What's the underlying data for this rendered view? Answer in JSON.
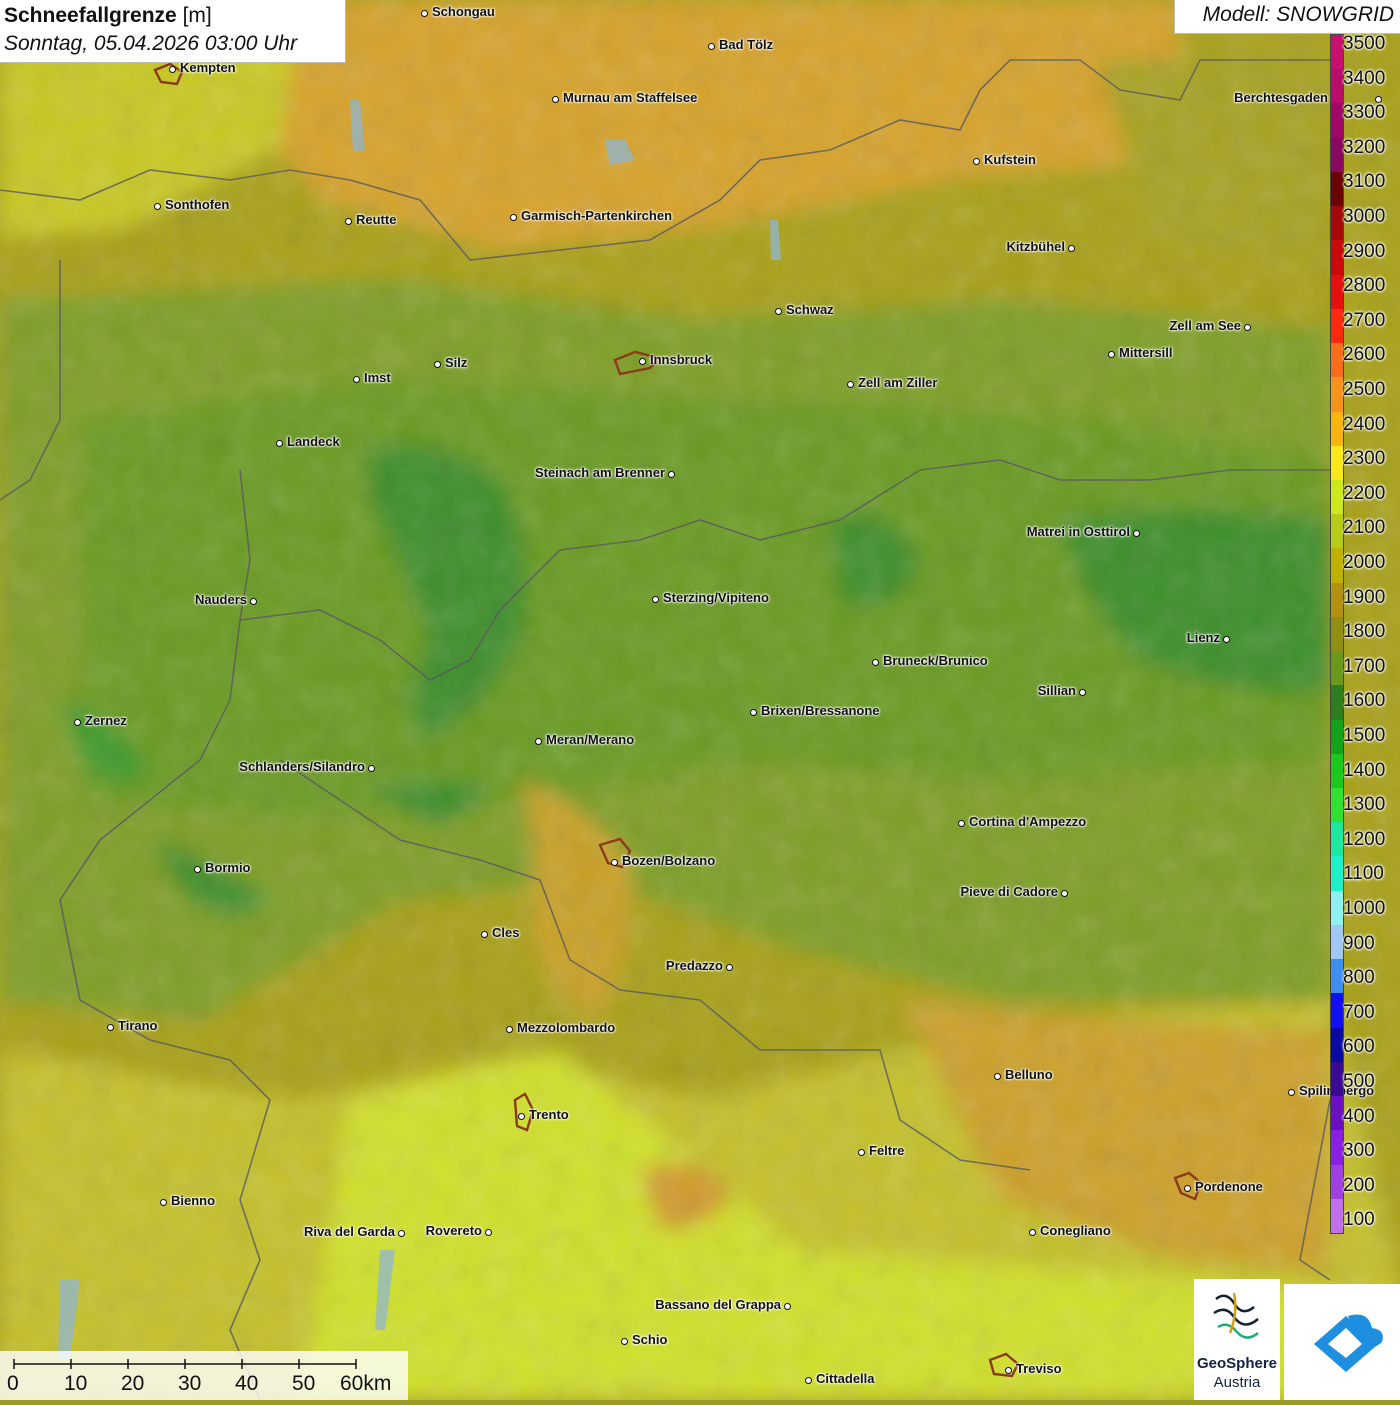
{
  "header": {
    "title_bold": "Schneefallgrenze",
    "title_unit": "[m]",
    "datetime": "Sonntag, 05.04.2026 03:00 Uhr",
    "model": "Modell: SNOWGRID"
  },
  "legend": {
    "labels": [
      "3500",
      "3400",
      "3300",
      "3200",
      "3100",
      "3000",
      "2900",
      "2800",
      "2700",
      "2600",
      "2500",
      "2400",
      "2300",
      "2200",
      "2100",
      "2000",
      "1900",
      "1800",
      "1700",
      "1600",
      "1500",
      "1400",
      "1300",
      "1200",
      "1100",
      "1000",
      "900",
      "800",
      "700",
      "600",
      "500",
      "400",
      "300",
      "200",
      "100"
    ],
    "colors": [
      "#c8106e",
      "#b80d6a",
      "#a00a66",
      "#8a0860",
      "#6a0505",
      "#a40a0a",
      "#c80a0a",
      "#e41010",
      "#fb2a0f",
      "#f76d1a",
      "#f6931a",
      "#f8b410",
      "#fbe81a",
      "#cbe91c",
      "#b6cc18",
      "#c0b000",
      "#b49010",
      "#8f8f12",
      "#6b9a1a",
      "#2e7d1e",
      "#15a11a",
      "#1cc81c",
      "#32e032",
      "#1ee8a0",
      "#20f0c8",
      "#90f0f0",
      "#a0c8f0",
      "#3e8ef0",
      "#1010f0",
      "#0a0aa0",
      "#3a0a90",
      "#6a10c0",
      "#8a20e0",
      "#a040e0",
      "#c070e8"
    ]
  },
  "cities": [
    {
      "name": "Schongau"
    },
    {
      "name": "Kempten"
    },
    {
      "name": "Bad Tölz"
    },
    {
      "name": "Murnau am Staffelsee"
    },
    {
      "name": "Berchtesgaden"
    },
    {
      "name": "Kufstein"
    },
    {
      "name": "Sonthofen"
    },
    {
      "name": "Reutte"
    },
    {
      "name": "Garmisch-Partenkirchen"
    },
    {
      "name": "Kitzbühel"
    },
    {
      "name": "Schwaz"
    },
    {
      "name": "Zell am See"
    },
    {
      "name": "Innsbruck"
    },
    {
      "name": "Mittersill"
    },
    {
      "name": "Imst"
    },
    {
      "name": "Silz"
    },
    {
      "name": "Zell am Ziller"
    },
    {
      "name": "Landeck"
    },
    {
      "name": "Steinach am Brenner"
    },
    {
      "name": "Matrei in Osttirol"
    },
    {
      "name": "Nauders"
    },
    {
      "name": "Sterzing/Vipiteno"
    },
    {
      "name": "Lienz"
    },
    {
      "name": "Bruneck/Brunico"
    },
    {
      "name": "Sillian"
    },
    {
      "name": "Zernez"
    },
    {
      "name": "Brixen/Bressanone"
    },
    {
      "name": "Meran/Merano"
    },
    {
      "name": "Schlanders/Silandro"
    },
    {
      "name": "Cortina d'Ampezzo"
    },
    {
      "name": "Bozen/Bolzano"
    },
    {
      "name": "Bormio"
    },
    {
      "name": "Pieve di Cadore"
    },
    {
      "name": "Cles"
    },
    {
      "name": "Predazzo"
    },
    {
      "name": "Tirano"
    },
    {
      "name": "Mezzolombardo"
    },
    {
      "name": "Belluno"
    },
    {
      "name": "Spilimbergo"
    },
    {
      "name": "Trento"
    },
    {
      "name": "Feltre"
    },
    {
      "name": "Pordenone"
    },
    {
      "name": "Bienno"
    },
    {
      "name": "Riva del Garda"
    },
    {
      "name": "Rovereto"
    },
    {
      "name": "Conegliano"
    },
    {
      "name": "Bassano del Grappa"
    },
    {
      "name": "Schio"
    },
    {
      "name": "Cittadella"
    },
    {
      "name": "Treviso"
    }
  ],
  "scale": {
    "labels": [
      "0",
      "10",
      "20",
      "30",
      "40",
      "50",
      "60km"
    ]
  },
  "logos": {
    "geosphere_line1": "GeoSphere",
    "geosphere_line2": "Austria"
  }
}
